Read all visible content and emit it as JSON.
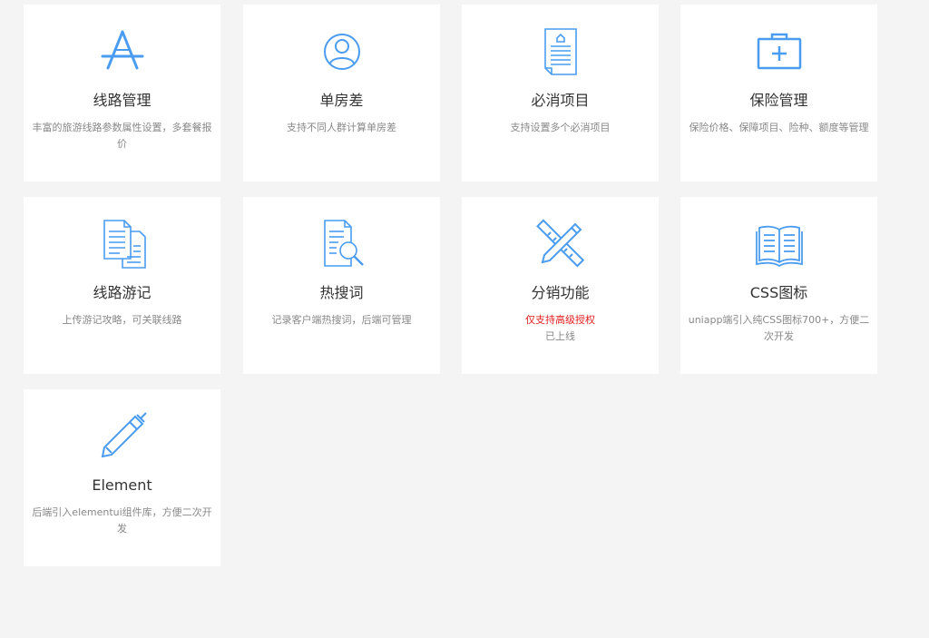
{
  "colors": {
    "background": "#f4f4f4",
    "card": "#ffffff",
    "icon": "#4a9cf0",
    "title": "#333333",
    "desc": "#888888",
    "warn": "#e02020"
  },
  "cards": [
    {
      "icon": "app-store-icon",
      "title": "线路管理",
      "desc": "丰富的旅游线路参数属性设置，多套餐报价"
    },
    {
      "icon": "user-icon",
      "title": "单房差",
      "desc": "支持不同人群计算单房差"
    },
    {
      "icon": "document-icon",
      "title": "必消项目",
      "desc": "支持设置多个必消项目"
    },
    {
      "icon": "medical-kit-icon",
      "title": "保险管理",
      "desc": "保险价格、保障项目、险种、额度等管理"
    },
    {
      "icon": "documents-icon",
      "title": "线路游记",
      "desc": "上传游记攻略，可关联线路"
    },
    {
      "icon": "search-document-icon",
      "title": "热搜词",
      "desc": "记录客户端热搜词，后端可管理"
    },
    {
      "icon": "ruler-pencil-icon",
      "title": "分销功能",
      "warning": "仅支持高级授权",
      "desc": "已上线"
    },
    {
      "icon": "book-icon",
      "title": "CSS图标",
      "desc": "uniapp端引入纯CSS图标700+，方便二次开发"
    },
    {
      "icon": "pen-icon",
      "title": "Element",
      "desc": "后端引入elementui组件库，方便二次开发"
    }
  ]
}
